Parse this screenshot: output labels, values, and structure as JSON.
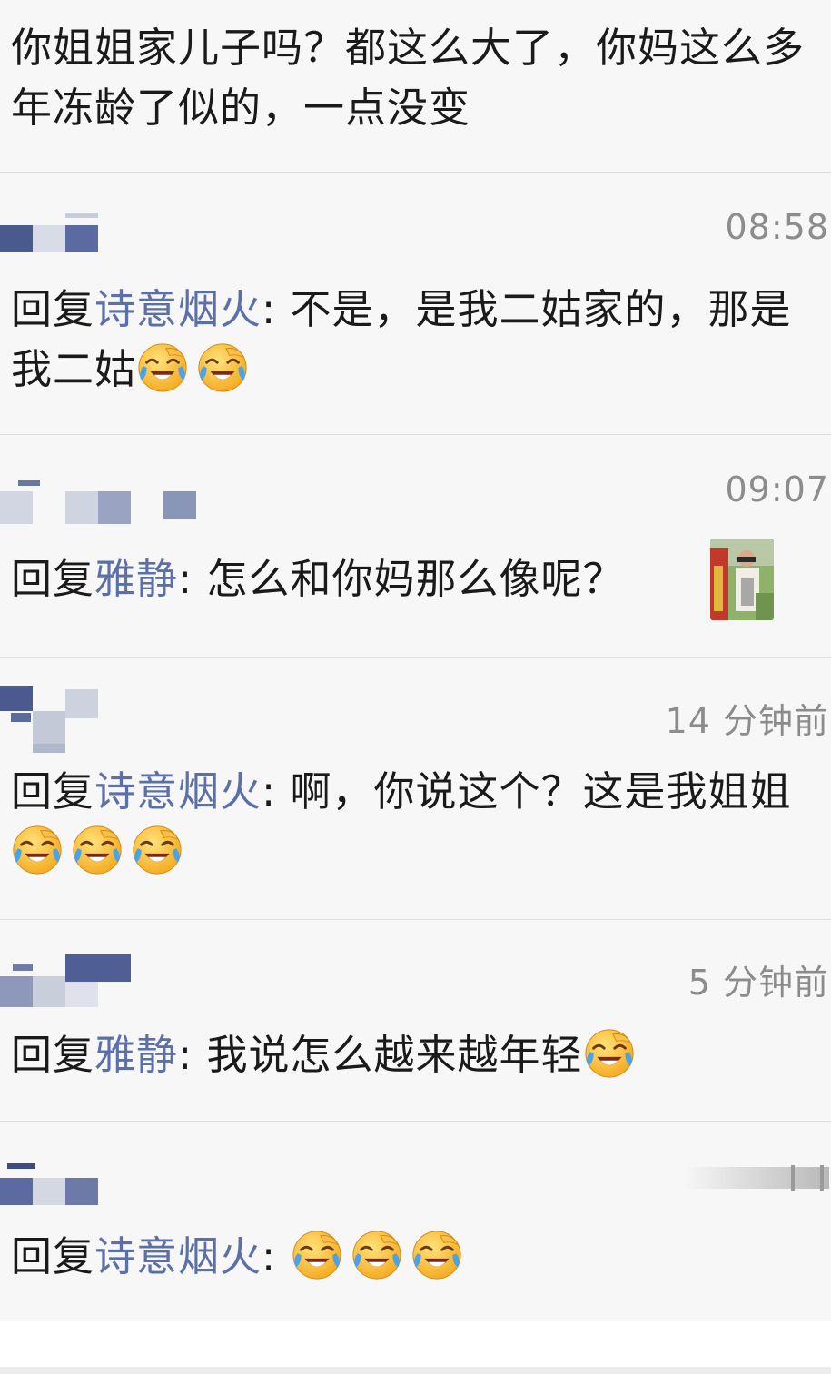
{
  "top_comment": {
    "text": "你姐姐家儿子吗？都这么大了，你妈这么多年冻龄了似的，一点没变"
  },
  "replies": [
    {
      "timestamp": "08:58",
      "prefix": "回复",
      "username": "诗意烟火",
      "text": ": 不是，是我二姑家的，那是我二姑",
      "emojis": [
        "laughing-crying-emoji",
        "laughing-crying-emoji"
      ]
    },
    {
      "timestamp": "09:07",
      "prefix": "回复",
      "username": "雅静",
      "text": ": 怎么和你妈那么像呢？",
      "emojis": []
    },
    {
      "timestamp": "14 分钟前",
      "prefix": "回复",
      "username": "诗意烟火",
      "text": ": 啊，你说这个？这是我姐姐",
      "emojis": [
        "laughing-crying-emoji",
        "laughing-crying-emoji",
        "laughing-crying-emoji"
      ]
    },
    {
      "timestamp": "5 分钟前",
      "prefix": "回复",
      "username": "雅静",
      "text": ": 我说怎么越来越年轻",
      "emojis": [
        "laughing-crying-emoji"
      ]
    },
    {
      "timestamp": "",
      "prefix": "回复",
      "username": "诗意烟火",
      "text": ": ",
      "emojis": [
        "laughing-crying-emoji",
        "laughing-crying-emoji",
        "laughing-crying-emoji"
      ]
    }
  ],
  "colors": {
    "username": "#5b6fa8",
    "timestamp": "#8c8c8c",
    "background": "#f7f7f7",
    "divider": "#dedede"
  }
}
